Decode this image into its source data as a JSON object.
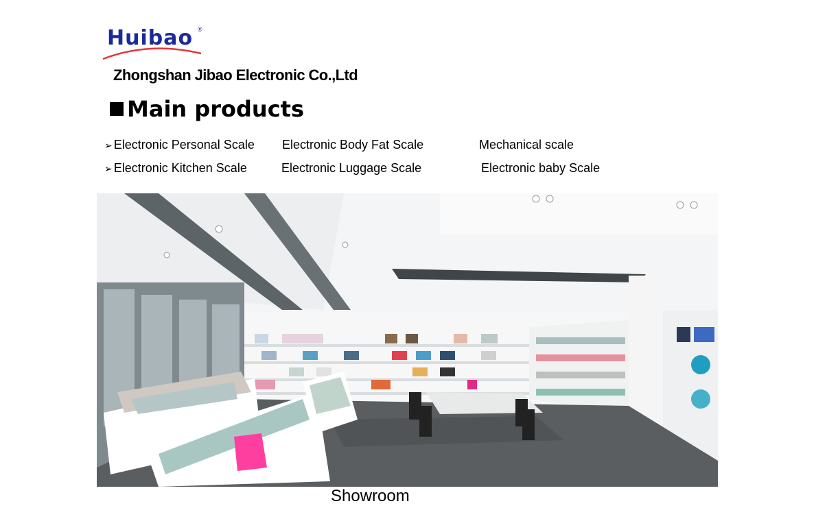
{
  "logo": {
    "brand": "Huibao",
    "registered": "®"
  },
  "company": "Zhongshan Jibao  Electronic Co.,Ltd",
  "heading": "Main products",
  "products": {
    "row1": [
      "Electronic Personal Scale",
      "Electronic Body Fat Scale",
      "Mechanical scale"
    ],
    "row2": [
      "Electronic Kitchen Scale",
      "Electronic Luggage Scale",
      "Electronic baby Scale"
    ],
    "bullet": "➢"
  },
  "photo": {
    "subject": "showroom-photo"
  },
  "caption": "Showroom",
  "colors": {
    "logo_blue": "#1b2a9a",
    "logo_swoosh": "#e8343a"
  }
}
